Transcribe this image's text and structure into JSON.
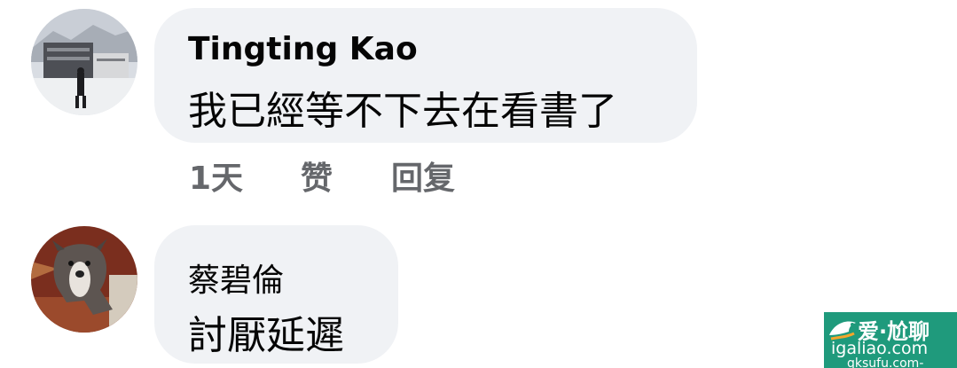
{
  "comments": [
    {
      "author": "Tingting Kao",
      "text": "我已經等不下去在看書了",
      "time": "1天",
      "like_label": "赞",
      "reply_label": "回复"
    },
    {
      "author": "蔡碧倫",
      "text": "討厭延遲"
    }
  ],
  "watermark": {
    "title": "爱·尬聊",
    "url": "igaliao.com",
    "sub": "qksufu.com-"
  },
  "colors": {
    "bubble": "#f0f2f5",
    "secondary_text": "#65676b",
    "watermark_bg": "#1f9a7c"
  }
}
